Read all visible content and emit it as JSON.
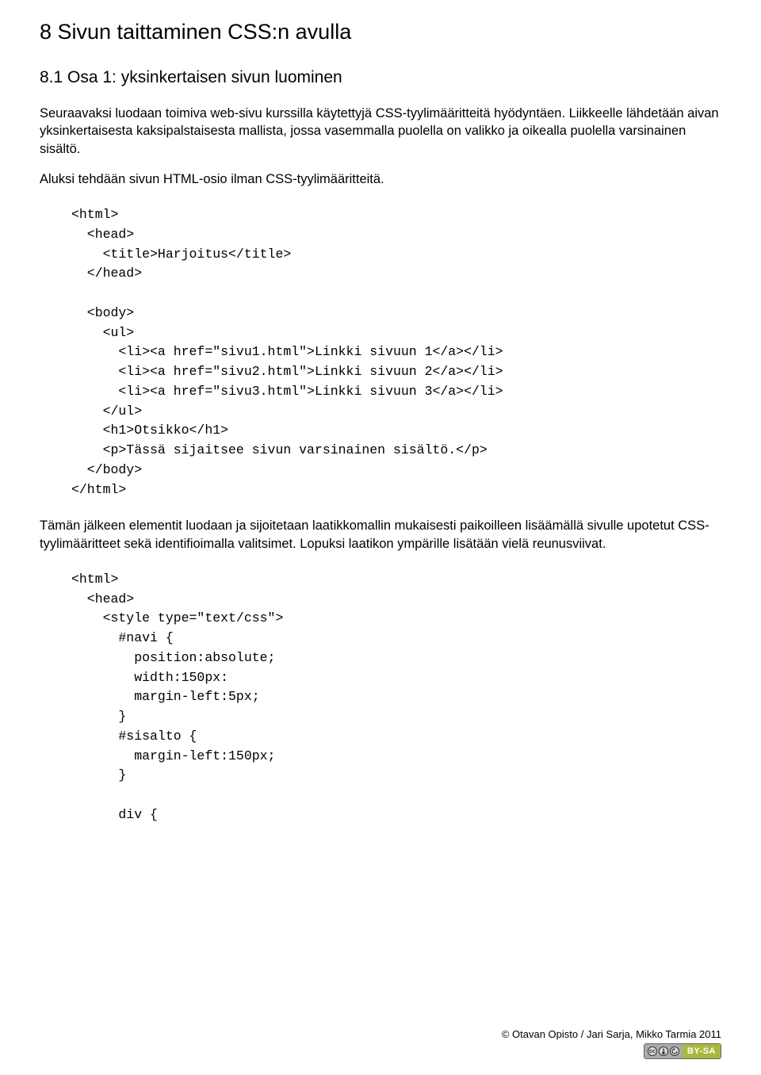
{
  "heading1": "8 Sivun taittaminen CSS:n avulla",
  "heading2": "8.1 Osa 1: yksinkertaisen sivun luominen",
  "para1": "Seuraavaksi luodaan toimiva web-sivu kurssilla käytettyjä CSS-tyylimääritteitä hyödyntäen. Liikkeelle lähdetään aivan yksinkertaisesta kaksipalstaisesta mallista, jossa vasemmalla puolella on valikko ja oikealla puolella varsinainen sisältö.",
  "para2": "Aluksi tehdään sivun HTML-osio ilman CSS-tyylimääritteitä.",
  "code1": "<html>\n  <head>\n    <title>Harjoitus</title>\n  </head>\n\n  <body>\n    <ul>\n      <li><a href=\"sivu1.html\">Linkki sivuun 1</a></li>\n      <li><a href=\"sivu2.html\">Linkki sivuun 2</a></li>\n      <li><a href=\"sivu3.html\">Linkki sivuun 3</a></li>\n    </ul>\n    <h1>Otsikko</h1>\n    <p>Tässä sijaitsee sivun varsinainen sisältö.</p>\n  </body>\n</html>",
  "para3": "Tämän jälkeen elementit luodaan ja sijoitetaan laatikkomallin mukaisesti paikoilleen lisäämällä sivulle upotetut CSS-tyylimääritteet sekä identifioimalla valitsimet. Lopuksi laatikon ympärille lisätään vielä reunusviivat.",
  "code2": "<html>\n  <head>\n    <style type=\"text/css\">\n      #navi {\n        position:absolute;\n        width:150px:\n        margin-left:5px;\n      }\n      #sisalto {\n        margin-left:150px;\n      }\n\n      div {",
  "footer": "© Otavan Opisto / Jari Sarja, Mikko Tarmia 2011",
  "cc_label": "BY-SA"
}
